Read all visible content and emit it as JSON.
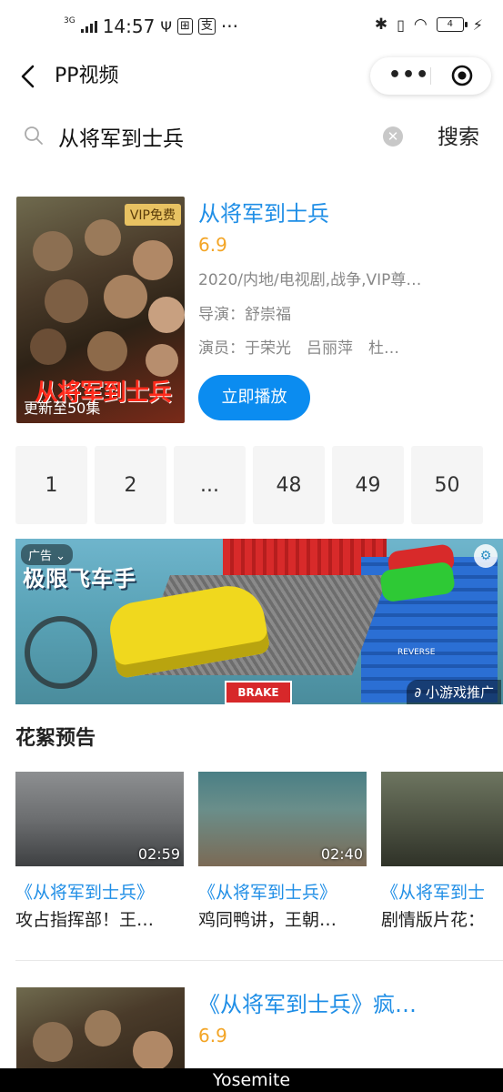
{
  "status_bar": {
    "network": "3G",
    "time": "14:57",
    "battery": "4"
  },
  "nav": {
    "title": "PP视频"
  },
  "search": {
    "query": "从将军到士兵",
    "button": "搜索"
  },
  "result": {
    "vip_tag": "VIP免费",
    "poster_title": "从将军到士兵",
    "episodes_note": "更新至50集",
    "title": "从将军到士兵",
    "score": "6.9",
    "meta": "2020/内地/电视剧,战争,VIP尊…",
    "director": "导演：舒崇福",
    "cast": "演员：于荣光　吕丽萍　杜…",
    "play_button": "立即播放",
    "episodes": [
      "1",
      "2",
      "...",
      "48",
      "49",
      "50"
    ]
  },
  "ad": {
    "tag": "广告",
    "game_title": "极限飞车手",
    "brake": "BRAKE",
    "reverse": "REVERSE",
    "source": "小游戏推广"
  },
  "clips_section": {
    "title": "花絮预告",
    "items": [
      {
        "duration": "02:59",
        "show": "《从将军到士兵》",
        "desc": "攻占指挥部！王…"
      },
      {
        "duration": "02:40",
        "show": "《从将军到士兵》",
        "desc": "鸡同鸭讲，王朝…"
      },
      {
        "duration": "",
        "show": "《从将军到士",
        "desc": "剧情版片花："
      }
    ]
  },
  "result2": {
    "title": "《从将军到士兵》疯…",
    "score": "6.9"
  },
  "footer": {
    "text": "Yosemite"
  },
  "colors": {
    "accent_blue": "#1f8ee6",
    "play_button": "#0b8cf0",
    "score": "#f3a526"
  }
}
